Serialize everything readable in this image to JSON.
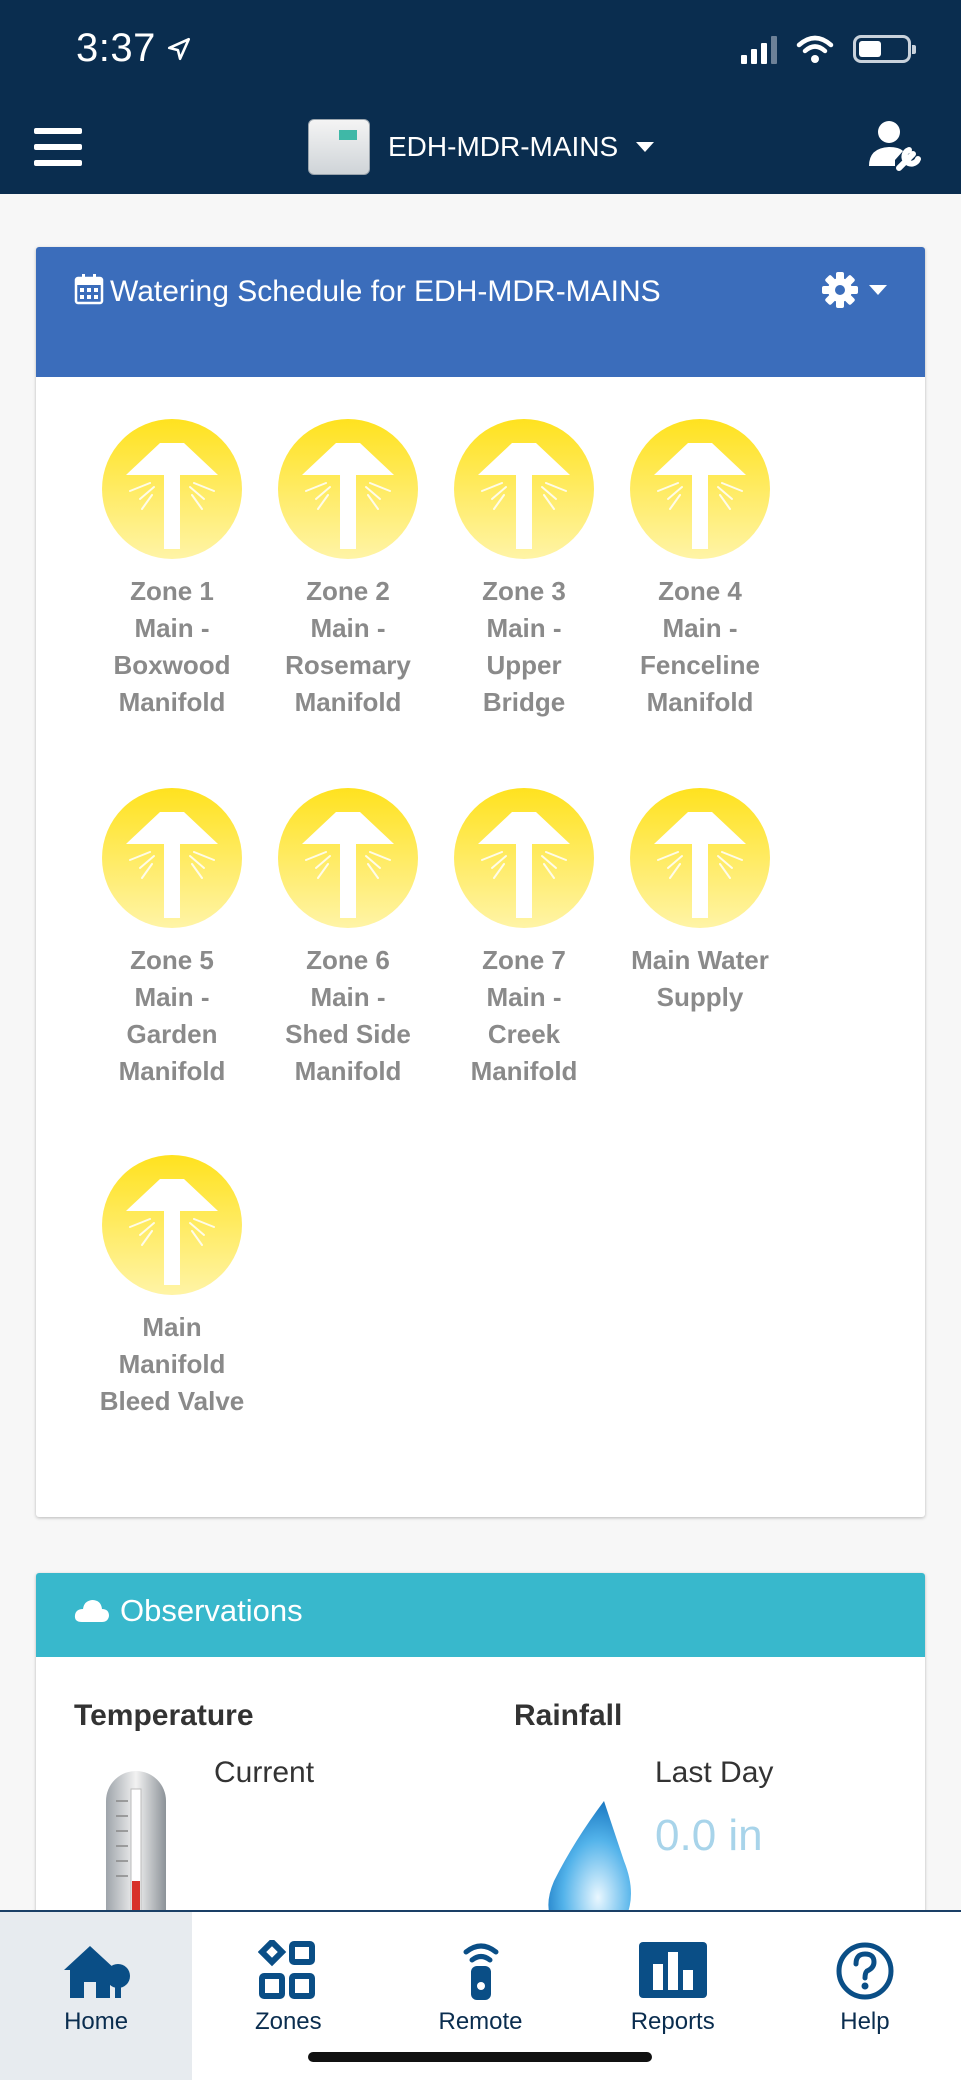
{
  "status_bar": {
    "time": "3:37"
  },
  "header": {
    "device_name": "EDH-MDR-MAINS"
  },
  "schedule": {
    "title": "Watering Schedule for EDH-MDR-MAINS",
    "zones": [
      {
        "lines": [
          "Zone 1",
          "Main -",
          "Boxwood",
          "Manifold"
        ]
      },
      {
        "lines": [
          "Zone 2",
          "Main -",
          "Rosemary",
          "Manifold"
        ]
      },
      {
        "lines": [
          "Zone 3",
          "Main -",
          "Upper",
          "Bridge"
        ]
      },
      {
        "lines": [
          "Zone 4",
          "Main -",
          "Fenceline",
          "Manifold"
        ]
      },
      {
        "lines": [
          "Zone 5",
          "Main -",
          "Garden",
          "Manifold"
        ]
      },
      {
        "lines": [
          "Zone 6",
          "Main -",
          "Shed Side",
          "Manifold"
        ]
      },
      {
        "lines": [
          "Zone 7",
          "Main -",
          "Creek",
          "Manifold"
        ]
      },
      {
        "lines": [
          "Main Water",
          "Supply"
        ]
      },
      {
        "lines": [
          "Main",
          "Manifold",
          "Bleed Valve"
        ]
      }
    ]
  },
  "observations": {
    "title": "Observations",
    "temperature": {
      "heading": "Temperature",
      "label": "Current"
    },
    "rainfall": {
      "heading": "Rainfall",
      "label": "Last Day",
      "value": "0.0 in"
    }
  },
  "nav": {
    "home": "Home",
    "zones": "Zones",
    "remote": "Remote",
    "reports": "Reports",
    "help": "Help"
  },
  "colors": {
    "header_bg": "#0a2d4f",
    "schedule_header": "#3b6dbb",
    "observations_header": "#38b8cc",
    "sprinkler_yellow": "#ffe633"
  }
}
